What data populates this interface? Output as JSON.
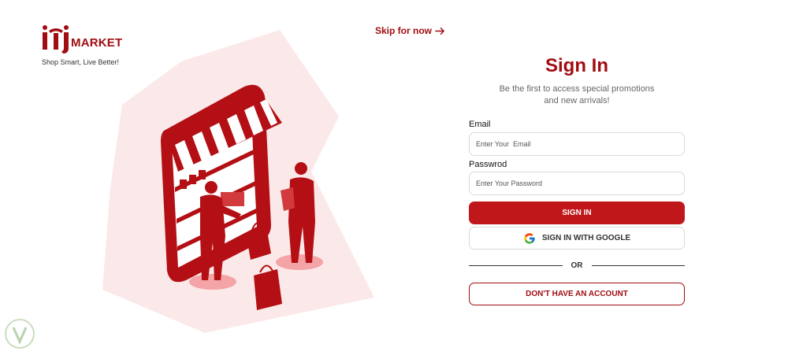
{
  "brand": {
    "logo_mark_letters": "iti",
    "name": "MARKET",
    "tagline": "Shop Smart, Live Better!",
    "color": "#a00d12"
  },
  "header": {
    "skip_label": "Skip for now",
    "skip_icon": "arrow-right-icon"
  },
  "illustration": {
    "description_icon": "storefront-illustration",
    "accent_color": "#b30f14",
    "background_color": "#fbe9e9"
  },
  "form": {
    "title": "Sign In",
    "subtitle_line1": "Be the first to access special promotions",
    "subtitle_line2": "and new arrivals!",
    "email_label": "Email",
    "email_placeholder": "Enter Your  Email",
    "email_value": "",
    "password_label": "Passwrod",
    "password_placeholder": "Enter Your Password",
    "password_value": "",
    "signin_label": "SIGN IN",
    "google_label": "SIGN IN WITH GOOGLE",
    "google_icon": "google-icon",
    "divider_label": "OR",
    "account_label": "DON'T HAVE AN ACCOUNT",
    "primary_color": "#c0181a"
  },
  "watermark": {
    "icon": "shield-watermark-icon"
  }
}
